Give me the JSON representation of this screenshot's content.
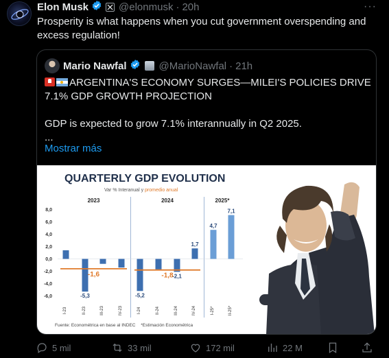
{
  "tweet": {
    "author_name": "Elon Musk",
    "handle": "@elonmusk",
    "separator": "·",
    "time": "20h",
    "more_glyph": "···",
    "text": "Prosperity is what happens when you cut government overspending and excess regulation!"
  },
  "quote": {
    "author_name": "Mario Nawfal",
    "handle": "@MarioNawfal",
    "separator": "·",
    "time": "21h",
    "headline": "ARGENTINA'S ECONOMY SURGES—MILEI'S POLICIES DRIVE 7.1% GDP GROWTH PROJECTION",
    "body": "GDP is expected to grow 7.1% interannually in Q2 2025.",
    "ellipsis": "...",
    "show_more": "Mostrar más"
  },
  "chart_data": {
    "type": "bar",
    "title": "QUARTERLY GDP EVOLUTION",
    "subtitle_part1": "Var % Interanual y",
    "subtitle_part2": "promedio anual",
    "year_labels": [
      "2023",
      "2024",
      "2025*"
    ],
    "categories": [
      "I-23",
      "II-23",
      "III-23",
      "IV-23",
      "I-24",
      "II-24",
      "III-24",
      "IV-24",
      "I-25*",
      "II-25*"
    ],
    "values": [
      1.4,
      -5.3,
      -0.8,
      -1.4,
      -5.2,
      -1.7,
      -2.1,
      1.7,
      4.7,
      7.1
    ],
    "data_labels": [
      "",
      "-5,3",
      "",
      "",
      "-5,2",
      "",
      "-2,1",
      "1,7",
      "4,7",
      "7,1"
    ],
    "annual_averages": [
      {
        "label": "-1,6",
        "value": -1.6,
        "from": 0,
        "to": 3
      },
      {
        "label": "-1,8",
        "value": -1.8,
        "from": 4,
        "to": 7
      }
    ],
    "yticks": [
      "8,0",
      "6,0",
      "4,0",
      "2,0",
      "0,0",
      "-2,0",
      "-4,0",
      "-6,0"
    ],
    "ylim": [
      -6.5,
      8.5
    ],
    "source_part1": "Fuente: Econométrica en base al INDEC",
    "source_part2": "*Estimación Econométrica",
    "colors": {
      "bar": "#3d6fb0",
      "forecast_bar": "#6b9ed6",
      "average": "#e07a2a",
      "title": "#1f2f4a",
      "subtitle_accent": "#e07a2a",
      "divider": "#9fb6d6"
    }
  },
  "actions": {
    "replies": "5 mil",
    "retweets": "33 mil",
    "likes": "172 mil",
    "views": "22 M"
  }
}
